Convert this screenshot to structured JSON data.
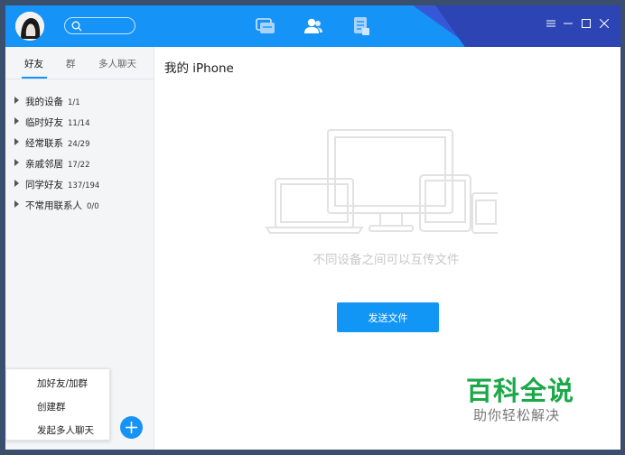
{
  "titlebar": {
    "nav": [
      {
        "name": "messages-icon",
        "active": false
      },
      {
        "name": "contacts-icon",
        "active": true
      },
      {
        "name": "files-icon",
        "active": false
      }
    ],
    "controls": [
      "menu-icon",
      "minimize-icon",
      "maximize-icon",
      "close-icon"
    ],
    "search": {
      "placeholder": ""
    }
  },
  "sidebar": {
    "tabs": [
      {
        "label": "好友",
        "active": true
      },
      {
        "label": "群",
        "active": false
      },
      {
        "label": "多人聊天",
        "active": false
      }
    ],
    "groups": [
      {
        "name": "我的设备",
        "count": "1/1"
      },
      {
        "name": "临时好友",
        "count": "11/14"
      },
      {
        "name": "经常联系",
        "count": "24/29"
      },
      {
        "name": "亲戚邻居",
        "count": "17/22"
      },
      {
        "name": "同学好友",
        "count": "137/194"
      },
      {
        "name": "不常用联系人",
        "count": "0/0"
      }
    ]
  },
  "popup_menu": {
    "items": [
      "加好友/加群",
      "创建群",
      "发起多人聊天"
    ]
  },
  "main": {
    "title": "我的 iPhone",
    "hint": "不同设备之间可以互传文件",
    "send_button": "发送文件"
  },
  "watermark": {
    "line1": "百科全说",
    "line2": "助你轻松解决"
  },
  "colors": {
    "titlebar": "#1693f6",
    "accent": "#1296f5",
    "watermark_green": "#1aa848"
  }
}
